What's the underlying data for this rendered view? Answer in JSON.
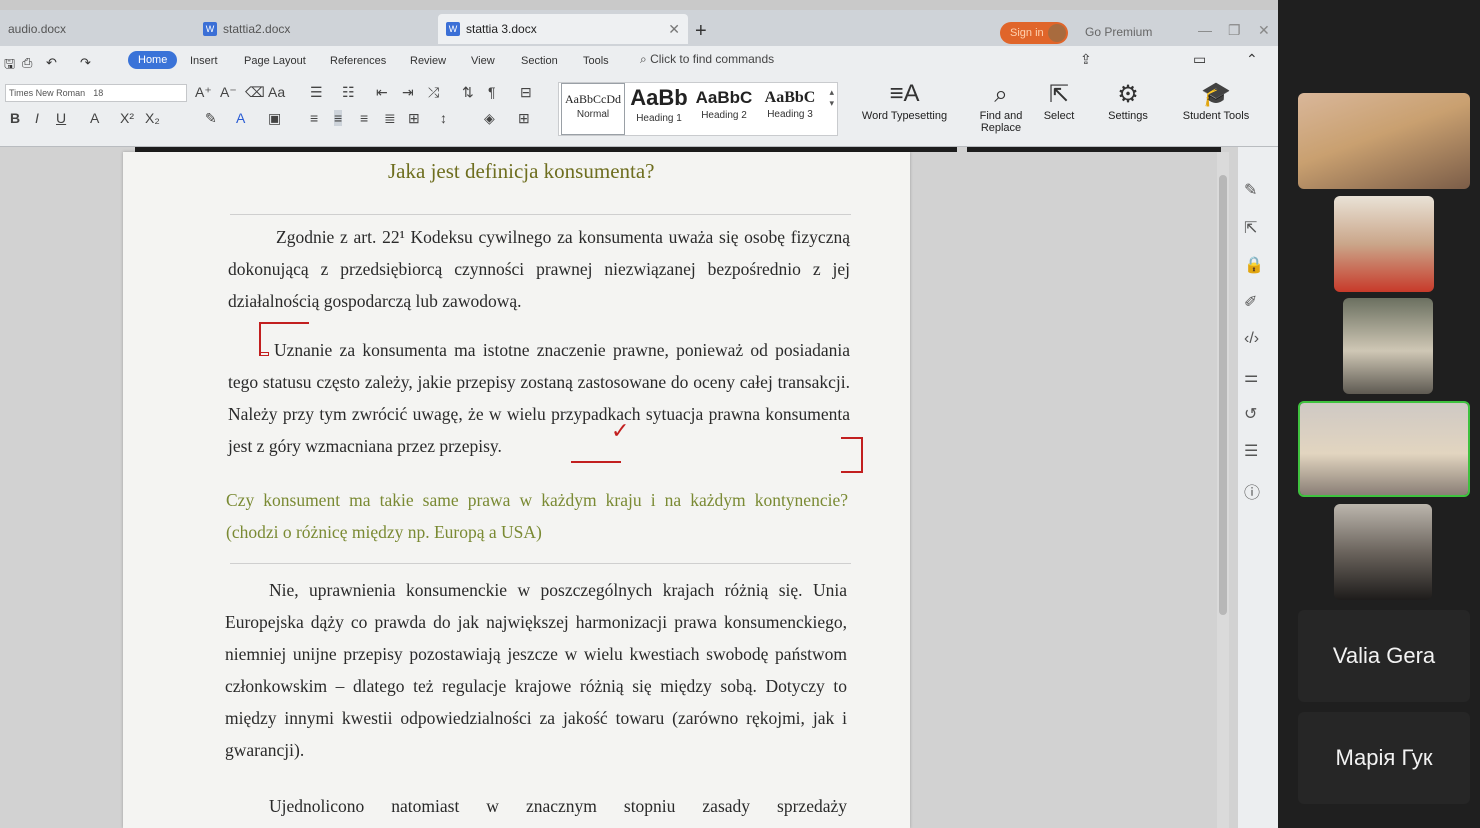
{
  "tabs": [
    {
      "label": "audio.docx",
      "active": false
    },
    {
      "label": "stattia2.docx",
      "active": false
    },
    {
      "label": "stattia 3.docx",
      "active": true
    }
  ],
  "titlebar": {
    "sign_in": "Sign in",
    "go_premium": "Go Premium"
  },
  "menu": [
    "Home",
    "Insert",
    "Page Layout",
    "References",
    "Review",
    "View",
    "Section",
    "Tools"
  ],
  "command_search": "Click to find commands",
  "font": {
    "name": "Times New Roman",
    "size": "18"
  },
  "styles": [
    {
      "preview": "AaBbCcDd",
      "label": "Normal"
    },
    {
      "preview": "AaBb",
      "label": "Heading 1"
    },
    {
      "preview": "AaBbC",
      "label": "Heading 2"
    },
    {
      "preview": "AaBbC",
      "label": "Heading 3"
    }
  ],
  "tools": {
    "word_typesetting": "Word Typesetting",
    "find_replace": "Find and Replace",
    "select": "Select",
    "settings": "Settings",
    "student_tools": "Student Tools"
  },
  "document": {
    "heading": "Jaka jest definicja konsumenta?",
    "p1": "Zgodnie z art. 22¹ Kodeksu cywilnego za konsumenta uważa się osobę fizyczną dokonującą z przedsiębiorcą czynności prawnej niezwiązanej bezpośrednio z jej działalnością gospodarczą lub zawodową.",
    "p2": "Uznanie za konsumenta ma istotne znaczenie prawne, ponieważ od posiadania tego statusu często zależy, jakie przepisy zostaną zastosowane do oceny całej transakcji. Należy przy tym zwrócić uwagę, że w wielu przypadkach sytuacja prawna konsumenta jest z góry wzmacniana przez przepisy.",
    "q": "Czy konsument ma takie same prawa w każdym kraju i na każdym kontynencie? (chodzi o różnicę między np. Europą a USA)",
    "p3": "Nie, uprawnienia konsumenckie w poszczególnych krajach różnią się. Unia Europejska dąży co prawda do jak największej harmonizacji prawa konsumenckiego, niemniej unijne przepisy pozostawiają jeszcze w wielu kwestiach swobodę państwom członkowskim – dlatego też regulacje krajowe różnią się między sobą. Dotyczy to między innymi kwestii odpowiedzialności za jakość towaru (zarówno rękojmi, jak i gwarancji).",
    "p4": "Ujednolicono natomiast w znacznym stopniu zasady sprzedaży"
  },
  "participants": [
    {
      "name": "Valia Gera"
    },
    {
      "name": "Марія Гук"
    }
  ]
}
